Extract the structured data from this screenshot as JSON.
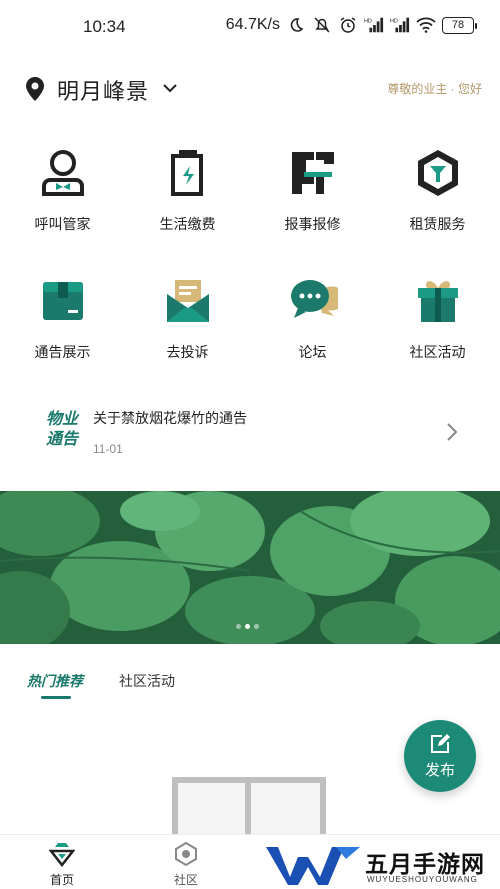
{
  "status_bar": {
    "time": "10:34",
    "network_speed": "64.7K/s",
    "battery": "78",
    "icons": [
      "moon-icon",
      "mute-icon",
      "alarm-icon",
      "signal-hd-icon",
      "signal-hd-icon",
      "wifi-icon",
      "battery-icon"
    ]
  },
  "header": {
    "community_name": "明月峰景",
    "greeting": "尊敬的业主 · 您好"
  },
  "services": [
    {
      "label": "呼叫管家",
      "icon": "butler-icon"
    },
    {
      "label": "生活缴费",
      "icon": "battery-bolt-icon"
    },
    {
      "label": "报事报修",
      "icon": "repair-icon"
    },
    {
      "label": "租赁服务",
      "icon": "lease-icon"
    },
    {
      "label": "通告展示",
      "icon": "notice-box-icon"
    },
    {
      "label": "去投诉",
      "icon": "complaint-mail-icon"
    },
    {
      "label": "论坛",
      "icon": "forum-chat-icon"
    },
    {
      "label": "社区活动",
      "icon": "gift-icon"
    }
  ],
  "notice": {
    "logo_line1": "物业",
    "logo_line2": "通告",
    "title": "关于禁放烟花爆竹的通告",
    "date": "11-01"
  },
  "banner": {
    "dot_count": 3,
    "active_dot": 1
  },
  "tabs": {
    "hot": "热门推荐",
    "community": "社区活动"
  },
  "fab": {
    "label": "发布",
    "icon": "edit-icon"
  },
  "bottom_nav": {
    "home": "首页",
    "community": "社区"
  },
  "watermark": {
    "title": "五月手游网",
    "subtitle": "WUYUESHOUYOUWANG"
  },
  "colors": {
    "primary": "#1b7a6c",
    "accent_gold": "#b5986a",
    "fab": "#1d8a77"
  }
}
